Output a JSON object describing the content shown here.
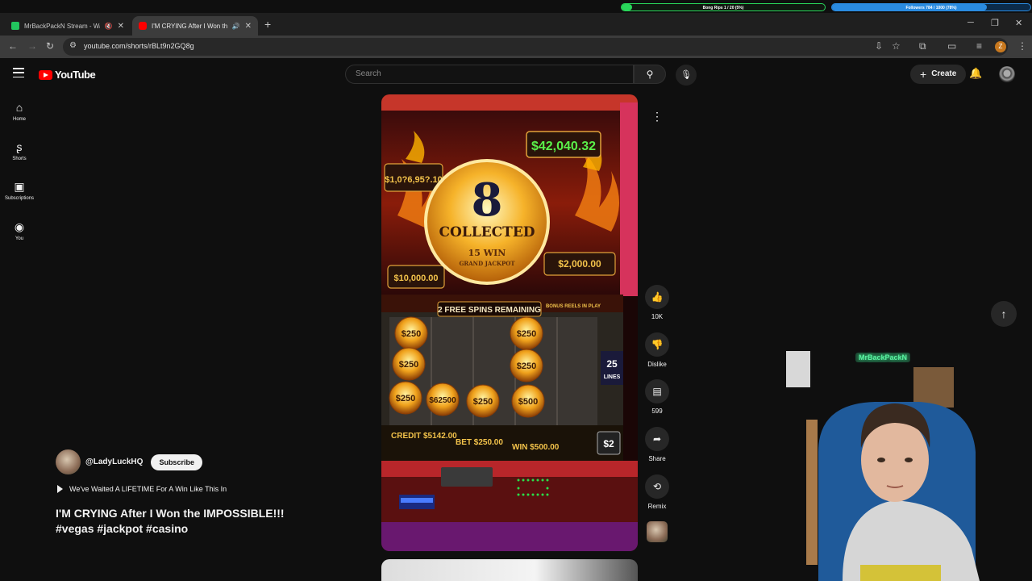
{
  "overlay": {
    "bong_rips": {
      "label": "Bong Rips 1 / 20 (5%)",
      "progress": 0.05
    },
    "followers": {
      "label": "Followers 784 / 1000 (78%)",
      "progress": 0.78
    }
  },
  "browser": {
    "tabs": [
      {
        "title": "MrBackPackN Stream - Wat",
        "favicon_color": "#22c55e",
        "active": false
      },
      {
        "title": "I'M CRYING After I Won the",
        "favicon_color": "#ff0000",
        "active": true
      }
    ],
    "url": "youtube.com/shorts/rBLt9n2GQ8g",
    "profile_initial": "Z"
  },
  "youtube": {
    "logo_text": "YouTube",
    "search_placeholder": "Search",
    "create_label": "Create",
    "sidebar": [
      {
        "label": "Home",
        "icon": "home-icon"
      },
      {
        "label": "Shorts",
        "icon": "shorts-icon"
      },
      {
        "label": "Subscriptions",
        "icon": "subscriptions-icon"
      },
      {
        "label": "You",
        "icon": "you-icon"
      }
    ],
    "short": {
      "channel": "@LadyLuckHQ",
      "subscribe_label": "Subscribe",
      "music": "We've Waited A LIFETIME For A Win Like This In",
      "title": "I'M CRYING After I Won the IMPOSSIBLE!!!",
      "hashtags": "#vegas #jackpot #casino",
      "actions": {
        "likes": "10K",
        "dislike": "Dislike",
        "comments": "599",
        "share": "Share",
        "remix": "Remix"
      }
    }
  },
  "video_frame": {
    "jackpot_top": "$42,040.32",
    "grand_amount": "$1,0?6,95?.10",
    "collected_count": "8",
    "collected_label": "COLLECTED",
    "win_line": "15 WIN",
    "grand_label": "GRAND JACKPOT",
    "minor": "$10,000.00",
    "major": "$2,000.00",
    "free_spins": "2 FREE SPINS REMAINING",
    "bonus_reels": "BONUS REELS IN PLAY",
    "coin_values": [
      "$250",
      "$250",
      "$250",
      "$250",
      "$250",
      "$62500",
      "$250",
      "$500"
    ],
    "lines": "25",
    "lines_label": "LINES",
    "credit": "CREDIT $5142.00",
    "bet": "BET $250.00",
    "win": "WIN $500.00",
    "denom": "$2"
  },
  "webcam": {
    "name_sign": "MrBackPackN"
  }
}
